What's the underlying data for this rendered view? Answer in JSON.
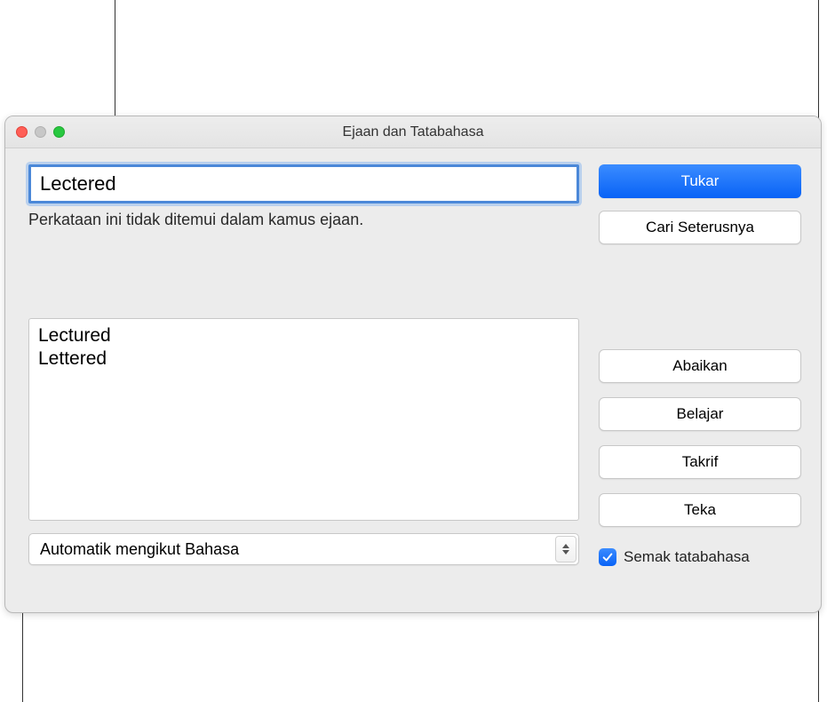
{
  "window": {
    "title": "Ejaan dan Tatabahasa"
  },
  "input": {
    "word": "Lectered",
    "status": "Perkataan ini tidak ditemui dalam kamus ejaan."
  },
  "suggestions": [
    "Lectured",
    "Lettered"
  ],
  "language_select": {
    "value": "Automatik mengikut Bahasa"
  },
  "buttons": {
    "change": "Tukar",
    "find_next": "Cari Seterusnya",
    "ignore": "Abaikan",
    "learn": "Belajar",
    "define": "Takrif",
    "guess": "Teka"
  },
  "checkbox": {
    "label": "Semak tatabahasa",
    "checked": true
  }
}
